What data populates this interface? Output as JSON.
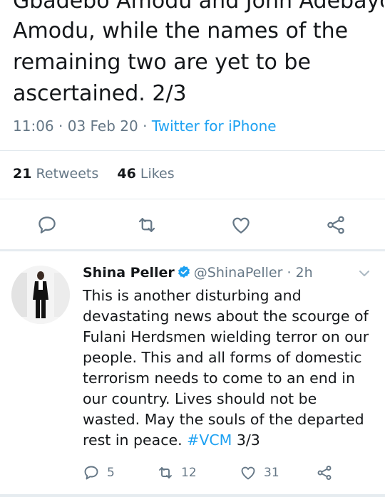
{
  "tweet": {
    "cut_text": "Gbadebo Amodu and John Adebayo, while the",
    "text": "Amodu, while the names of the remaining two are yet to be ascertained. 2/3",
    "time": "11:06",
    "date": "03 Feb 20",
    "source": "Twitter for iPhone",
    "retweets_count": "21",
    "retweets_label": "Retweets",
    "likes_count": "46",
    "likes_label": "Likes"
  },
  "actions": {
    "reply_icon": "reply-icon",
    "retweet_icon": "retweet-icon",
    "like_icon": "heart-icon",
    "share_icon": "share-icon"
  },
  "reply_tweet": {
    "name": "Shina Peller",
    "handle": "@ShinaPeller",
    "age": "2h",
    "text_before": "This is another disturbing and devastating news about the scourge of Fulani Herdsmen wielding terror on our people. This and all forms of domestic terrorism needs to come to an end in our country. Lives should not be wasted. May the souls of the departed rest in peace. ",
    "hashtag": "#VCM",
    "text_after": " 3/3",
    "replies": "5",
    "retweets": "12",
    "likes": "31"
  },
  "colors": {
    "text": "#14171a",
    "muted": "#657786",
    "accent": "#1da1f2",
    "divider": "#e1e8ed"
  }
}
